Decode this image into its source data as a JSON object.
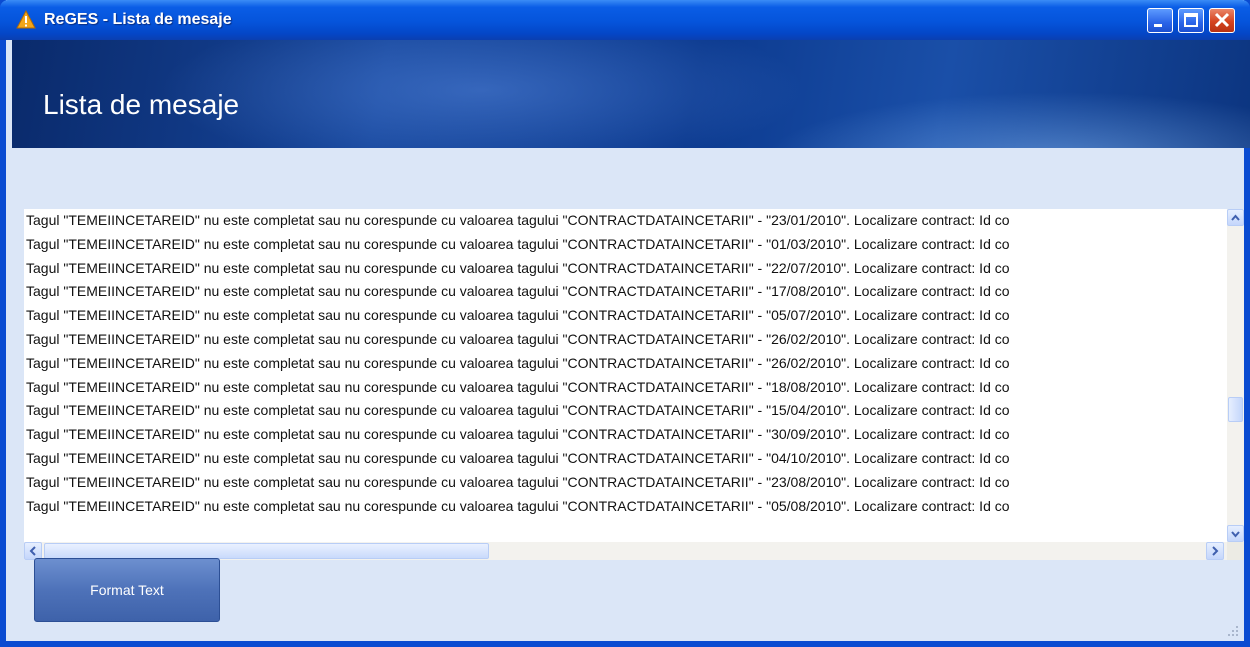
{
  "window": {
    "title": "ReGES - Lista de mesaje",
    "controls": [
      "minimize",
      "maximize",
      "close"
    ],
    "icon": "warning-icon"
  },
  "header": {
    "title": "Lista de mesaje"
  },
  "messages": [
    "Tagul \"TEMEIINCETAREID\" nu este completat sau nu corespunde cu valoarea tagului \"CONTRACTDATAINCETARII\" - \"23/01/2010\". Localizare contract: Id co",
    "Tagul \"TEMEIINCETAREID\" nu este completat sau nu corespunde cu valoarea tagului \"CONTRACTDATAINCETARII\" - \"01/03/2010\". Localizare contract: Id co",
    "Tagul \"TEMEIINCETAREID\" nu este completat sau nu corespunde cu valoarea tagului \"CONTRACTDATAINCETARII\" - \"22/07/2010\". Localizare contract: Id co",
    "Tagul \"TEMEIINCETAREID\" nu este completat sau nu corespunde cu valoarea tagului \"CONTRACTDATAINCETARII\" - \"17/08/2010\". Localizare contract: Id co",
    "Tagul \"TEMEIINCETAREID\" nu este completat sau nu corespunde cu valoarea tagului \"CONTRACTDATAINCETARII\" - \"05/07/2010\". Localizare contract: Id co",
    "Tagul \"TEMEIINCETAREID\" nu este completat sau nu corespunde cu valoarea tagului \"CONTRACTDATAINCETARII\" - \"26/02/2010\". Localizare contract: Id co",
    "Tagul \"TEMEIINCETAREID\" nu este completat sau nu corespunde cu valoarea tagului \"CONTRACTDATAINCETARII\" - \"26/02/2010\". Localizare contract: Id co",
    "Tagul \"TEMEIINCETAREID\" nu este completat sau nu corespunde cu valoarea tagului \"CONTRACTDATAINCETARII\" - \"18/08/2010\". Localizare contract: Id co",
    "Tagul \"TEMEIINCETAREID\" nu este completat sau nu corespunde cu valoarea tagului \"CONTRACTDATAINCETARII\" - \"15/04/2010\". Localizare contract: Id co",
    "Tagul \"TEMEIINCETAREID\" nu este completat sau nu corespunde cu valoarea tagului \"CONTRACTDATAINCETARII\" - \"30/09/2010\". Localizare contract: Id co",
    "Tagul \"TEMEIINCETAREID\" nu este completat sau nu corespunde cu valoarea tagului \"CONTRACTDATAINCETARII\" - \"04/10/2010\". Localizare contract: Id co",
    "Tagul \"TEMEIINCETAREID\" nu este completat sau nu corespunde cu valoarea tagului \"CONTRACTDATAINCETARII\" - \"23/08/2010\". Localizare contract: Id co",
    "Tagul \"TEMEIINCETAREID\" nu este completat sau nu corespunde cu valoarea tagului \"CONTRACTDATAINCETARII\" - \"05/08/2010\". Localizare contract: Id co"
  ],
  "buttons": {
    "format_text": "Format Text"
  },
  "colors": {
    "titlebar": "#0554db",
    "client_background": "#dbe6f7",
    "button": "#4e72b9"
  }
}
